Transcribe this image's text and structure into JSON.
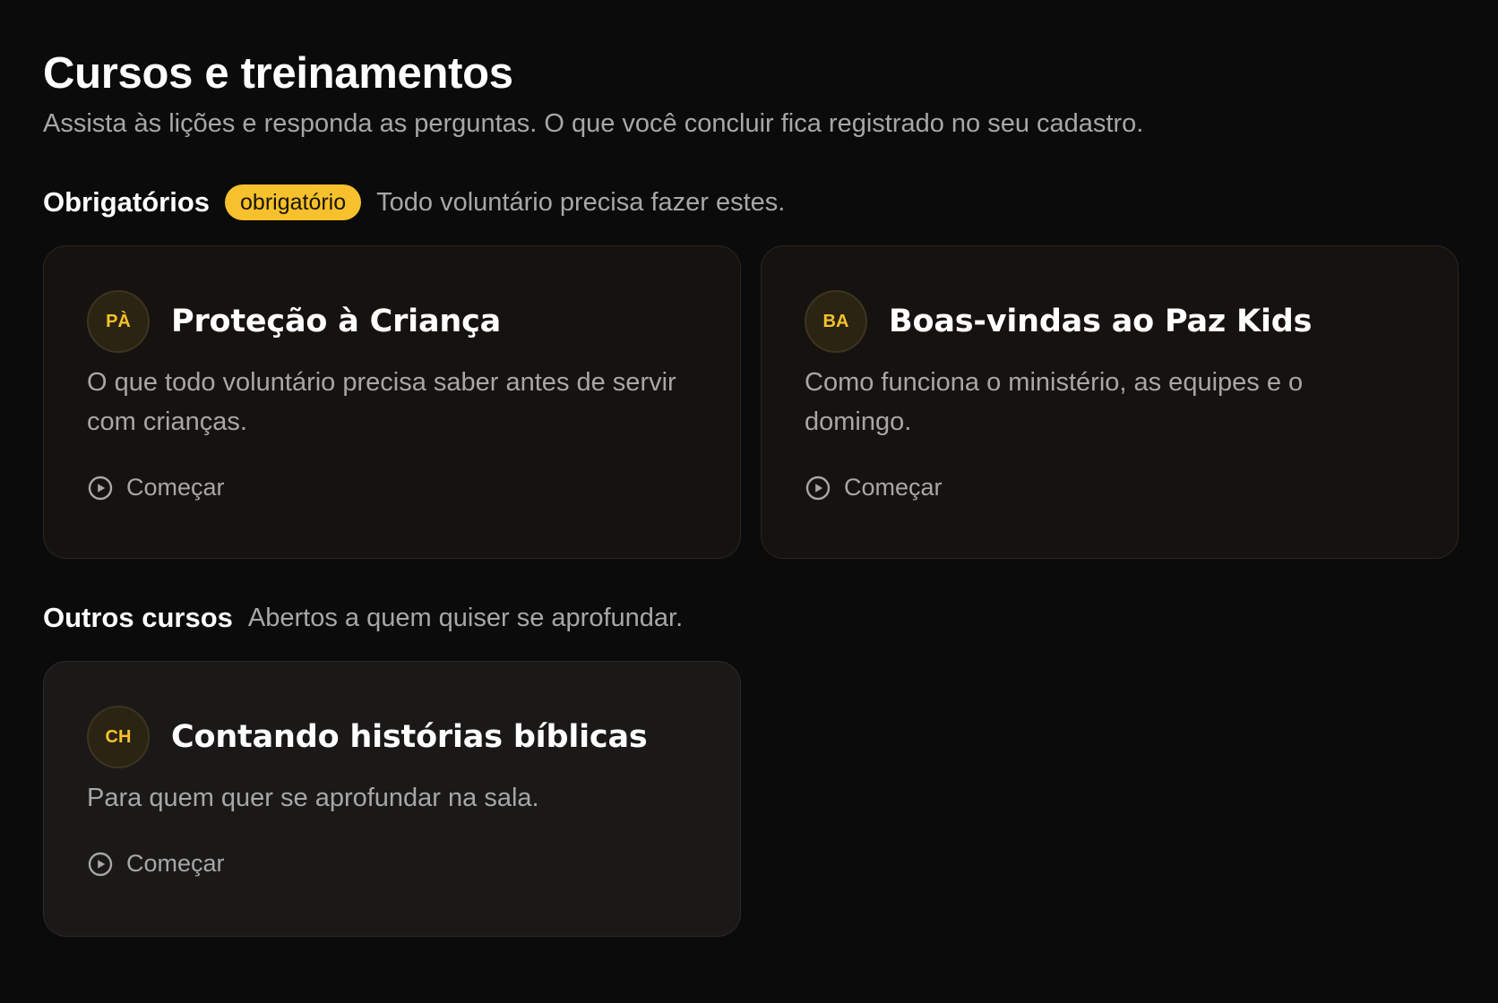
{
  "header": {
    "title": "Cursos e treinamentos",
    "subtitle": "Assista às lições e responda as perguntas. O que você concluir fica registrado no seu cadastro."
  },
  "required_section": {
    "title": "Obrigatórios",
    "badge": "obrigatório",
    "description": "Todo voluntário precisa fazer estes.",
    "courses": [
      {
        "initials": "PÀ",
        "title": "Proteção à Criança",
        "description": "O que todo voluntário precisa saber antes de servir com crianças.",
        "action_label": "Começar",
        "action_icon": "play-circle-icon"
      },
      {
        "initials": "BA",
        "title": "Boas-vindas ao Paz Kids",
        "description": "Como funciona o ministério, as equipes e o domingo.",
        "action_label": "Começar",
        "action_icon": "play-circle-icon"
      }
    ]
  },
  "other_section": {
    "title": "Outros cursos",
    "description": "Abertos a quem quiser se aprofundar.",
    "courses": [
      {
        "initials": "CH",
        "title": "Contando histórias bíblicas",
        "description": "Para quem quer se aprofundar na sala.",
        "action_label": "Começar",
        "action_icon": "play-circle-icon"
      }
    ]
  },
  "colors": {
    "background": "#0b0b0b",
    "accent": "#f6c12c",
    "card_required": "#161210",
    "card_other": "#1b1918",
    "muted_text": "#a7a7a7"
  }
}
